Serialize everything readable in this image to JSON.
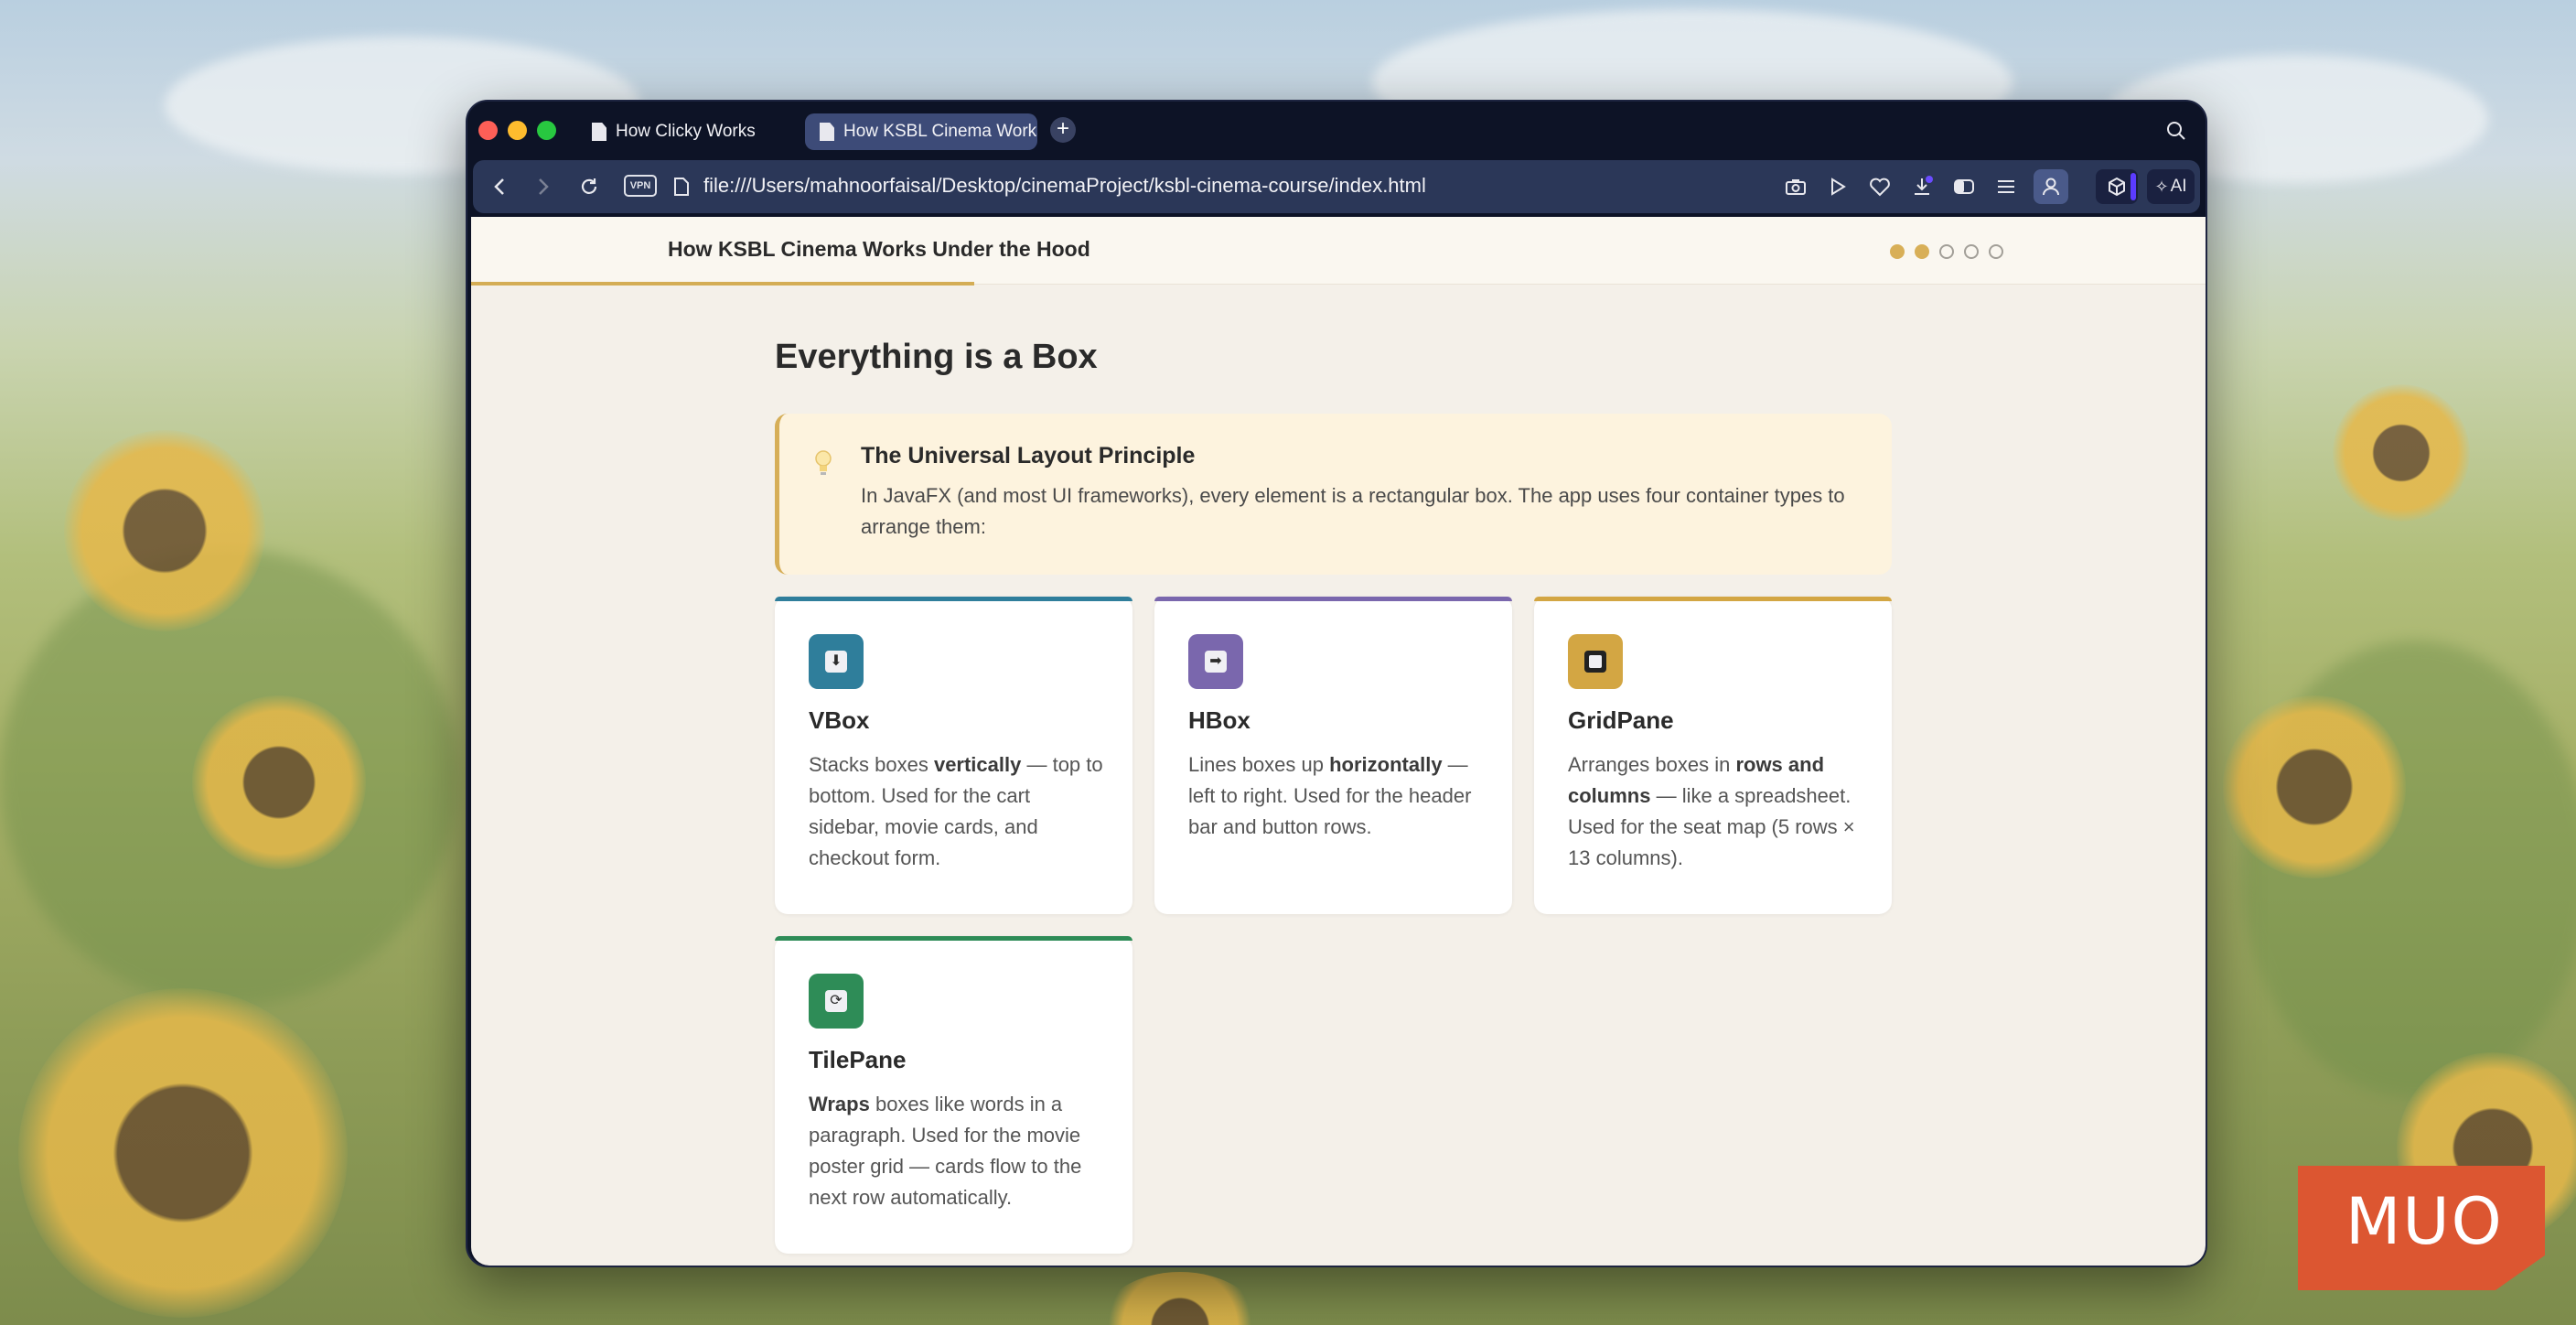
{
  "browser": {
    "tabs": [
      {
        "label": "How Clicky Works",
        "active": false
      },
      {
        "label": "How KSBL Cinema Works",
        "active": true
      }
    ],
    "url": "file:///Users/mahnoorfaisal/Desktop/cinemaProject/ksbl-cinema-course/index.html",
    "vpn_label": "VPN",
    "ai_label": "AI"
  },
  "page": {
    "header_title": "How KSBL Cinema Works Under the Hood",
    "progress_dots": [
      {
        "state": "filled"
      },
      {
        "state": "filled"
      },
      {
        "state": "empty"
      },
      {
        "state": "empty"
      },
      {
        "state": "empty"
      }
    ],
    "progress_fraction": 0.29,
    "section_title": "Everything is a Box",
    "callout": {
      "title": "The Universal Layout Principle",
      "body": "In JavaFX (and most UI frameworks), every element is a rectangular box. The app uses four container types to arrange them:"
    },
    "cards": [
      {
        "title": "VBox",
        "icon": "down-arrow-icon",
        "accent": "#2f7e9b",
        "pre": "Stacks boxes ",
        "bold": "vertically",
        "post": " — top to bottom. Used for the cart sidebar, movie cards, and checkout form."
      },
      {
        "title": "HBox",
        "icon": "right-arrow-icon",
        "accent": "#7a67ad",
        "pre": "Lines boxes up ",
        "bold": "horizontally",
        "post": " — left to right. Used for the header bar and button rows."
      },
      {
        "title": "GridPane",
        "icon": "square-icon",
        "accent": "#d3a643",
        "pre": "Arranges boxes in ",
        "bold": "rows and columns",
        "post": " — like a spreadsheet. Used for the seat map (5 rows × 13 columns)."
      },
      {
        "title": "TilePane",
        "icon": "cycle-icon",
        "accent": "#2e8c57",
        "pre": "",
        "bold": "Wraps",
        "post": " boxes like words in a paragraph. Used for the movie poster grid — cards flow to the next row automatically."
      }
    ]
  },
  "watermark": "MUO"
}
